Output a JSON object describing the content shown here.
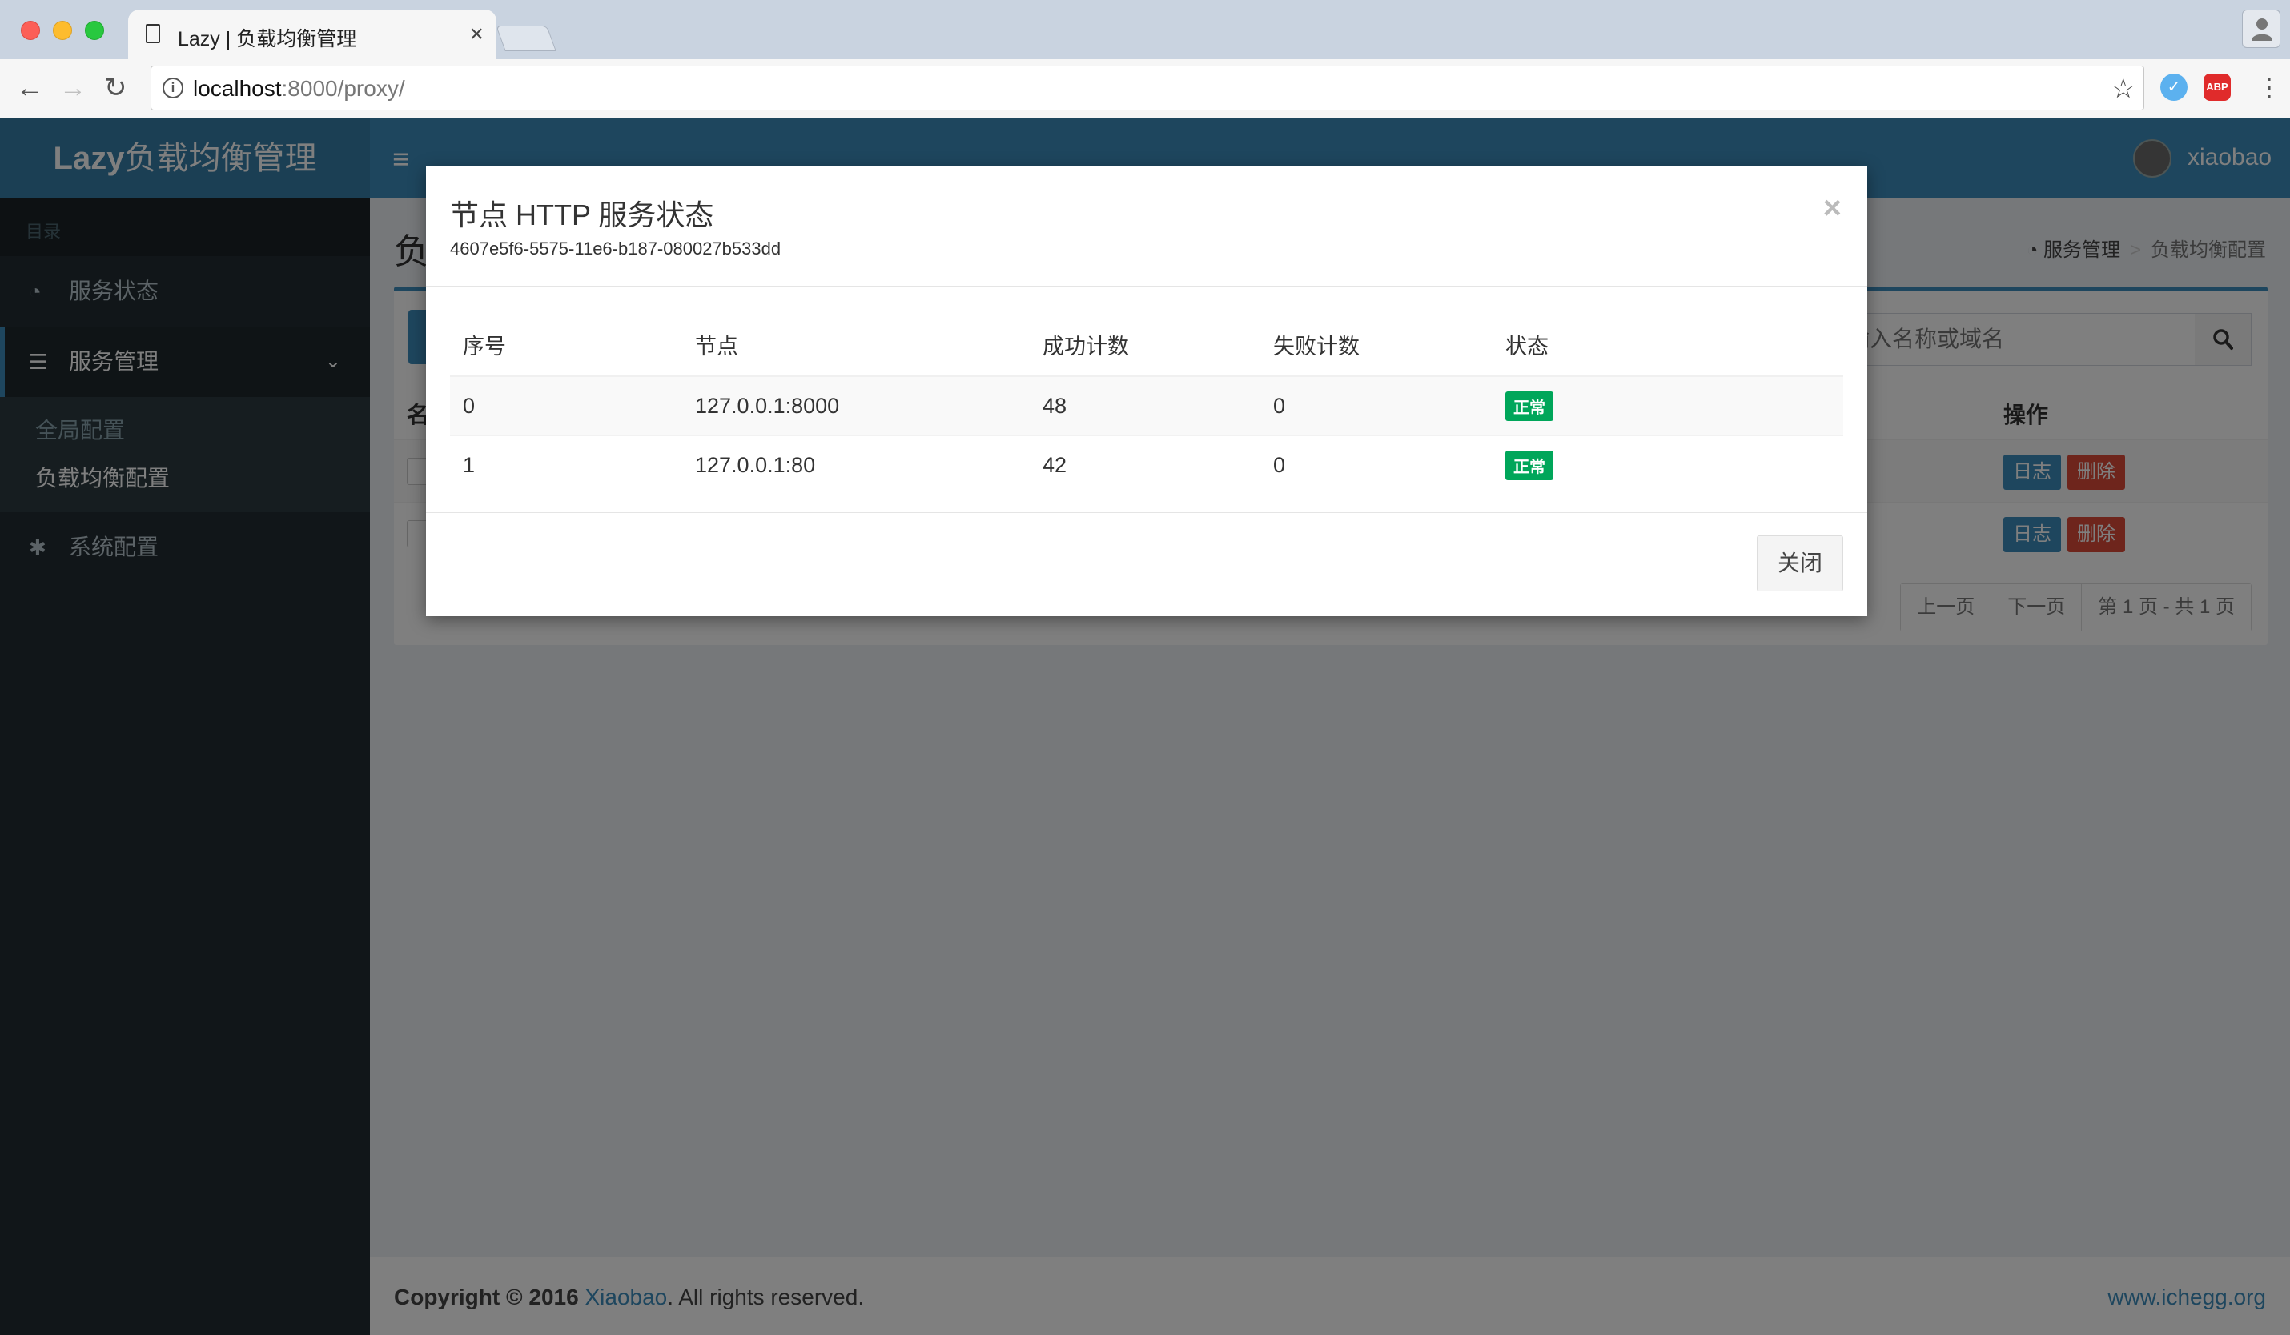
{
  "browser": {
    "tab_title": "Lazy | 负载均衡管理",
    "tab_close": "×",
    "url_host": "localhost",
    "url_path": ":8000/proxy/",
    "ext_abp": "ABP"
  },
  "app": {
    "logo_bold": "Lazy",
    "logo_rest": "负载均衡管理",
    "username": "xiaobao",
    "hamburger": "≡"
  },
  "sidebar": {
    "header": "目录",
    "items": [
      {
        "label": "服务状态",
        "icon": "dashboard-icon"
      },
      {
        "label": "服务管理",
        "icon": "server-icon",
        "expanded": true,
        "children": [
          "全局配置",
          "负载均衡配置"
        ]
      },
      {
        "label": "系统配置",
        "icon": "gear-icon"
      }
    ]
  },
  "content": {
    "title": "负",
    "breadcrumb": [
      "服务管理",
      "负载均衡配置"
    ],
    "search_placeholder": "请输入名称或域名",
    "col_name": "名",
    "col_action": "操作",
    "rows": [
      {
        "log": "日志",
        "delete": "删除"
      },
      {
        "log": "日志",
        "delete": "删除"
      }
    ],
    "pager": [
      "上一页",
      "下一页",
      "第 1 页 - 共 1 页"
    ]
  },
  "footer": {
    "copyright_prefix": "Copyright © 2016 ",
    "copyright_link": "Xiaobao",
    "copyright_suffix": ". All rights reserved.",
    "site": "www.ichegg.org"
  },
  "modal": {
    "title": "节点 HTTP 服务状态",
    "subtitle": "4607e5f6-5575-11e6-b187-080027b533dd",
    "close_x": "×",
    "columns": [
      "序号",
      "节点",
      "成功计数",
      "失败计数",
      "状态"
    ],
    "rows": [
      {
        "index": "0",
        "node": "127.0.0.1:8000",
        "success": "48",
        "fail": "0",
        "status": "正常"
      },
      {
        "index": "1",
        "node": "127.0.0.1:80",
        "success": "42",
        "fail": "0",
        "status": "正常"
      }
    ],
    "close_button": "关闭"
  },
  "colors": {
    "primary": "#3c8dbc",
    "sidebar_bg": "#222d32",
    "success": "#00a65a",
    "danger": "#dd4b39"
  }
}
